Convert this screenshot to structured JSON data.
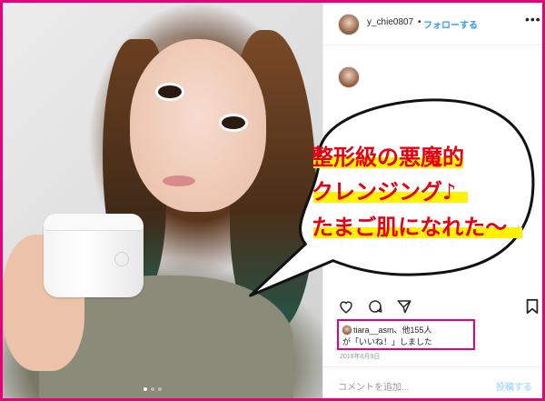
{
  "post": {
    "username": "y_chie0807",
    "separator": "•",
    "follow_label": "フォローする",
    "more_label": "•••",
    "likes_line1": "tiara__asm、他155人",
    "likes_line2": "が「いいね！」しました",
    "date": "2019年8月9日",
    "comment_placeholder": "コメントを追加...",
    "post_label": "投稿する"
  },
  "callout": {
    "line1": "整形級の悪魔的",
    "line2": "クレンジング♪",
    "line3": "たまご肌になれた〜"
  },
  "colors": {
    "frame": "#e8007a",
    "callout_text": "#e50012",
    "highlight": "#fff200",
    "link": "#3897f0"
  },
  "icons": [
    "heart-icon",
    "comment-icon",
    "share-icon",
    "bookmark-icon"
  ]
}
